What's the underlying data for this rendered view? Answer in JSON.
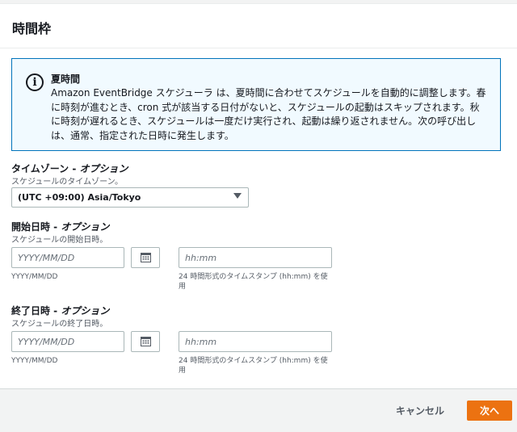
{
  "section": {
    "title": "時間枠"
  },
  "info": {
    "icon": "info-icon",
    "title": "夏時間",
    "text": "Amazon EventBridge スケジューラ は、夏時間に合わせてスケジュールを自動的に調整します。春に時刻が進むとき、cron 式が該当する日付がないと、スケジュールの起動はスキップされます。秋に時刻が遅れるとき、スケジュールは一度だけ実行され、起動は繰り返されません。次の呼び出しは、通常、指定された日時に発生します。"
  },
  "timezone": {
    "label": "タイムゾーン - ",
    "optional": "オプション",
    "description": "スケジュールのタイムゾーン。",
    "value": "(UTC +09:00) Asia/Tokyo"
  },
  "start": {
    "label": "開始日時 - ",
    "optional": "オプション",
    "description": "スケジュールの開始日時。",
    "date_placeholder": "YYYY/MM/DD",
    "date_hint": "YYYY/MM/DD",
    "time_placeholder": "hh:mm",
    "time_hint": "24 時間形式のタイムスタンプ (hh:mm) を使用"
  },
  "end": {
    "label": "終了日時 - ",
    "optional": "オプション",
    "description": "スケジュールの終了日時。",
    "date_placeholder": "YYYY/MM/DD",
    "date_hint": "YYYY/MM/DD",
    "time_placeholder": "hh:mm",
    "time_hint": "24 時間形式のタイムスタンプ (hh:mm) を使用"
  },
  "footer": {
    "cancel": "キャンセル",
    "next": "次へ"
  },
  "colors": {
    "primary": "#ec7211",
    "info_border": "#0073bb",
    "info_bg": "#f1faff"
  }
}
